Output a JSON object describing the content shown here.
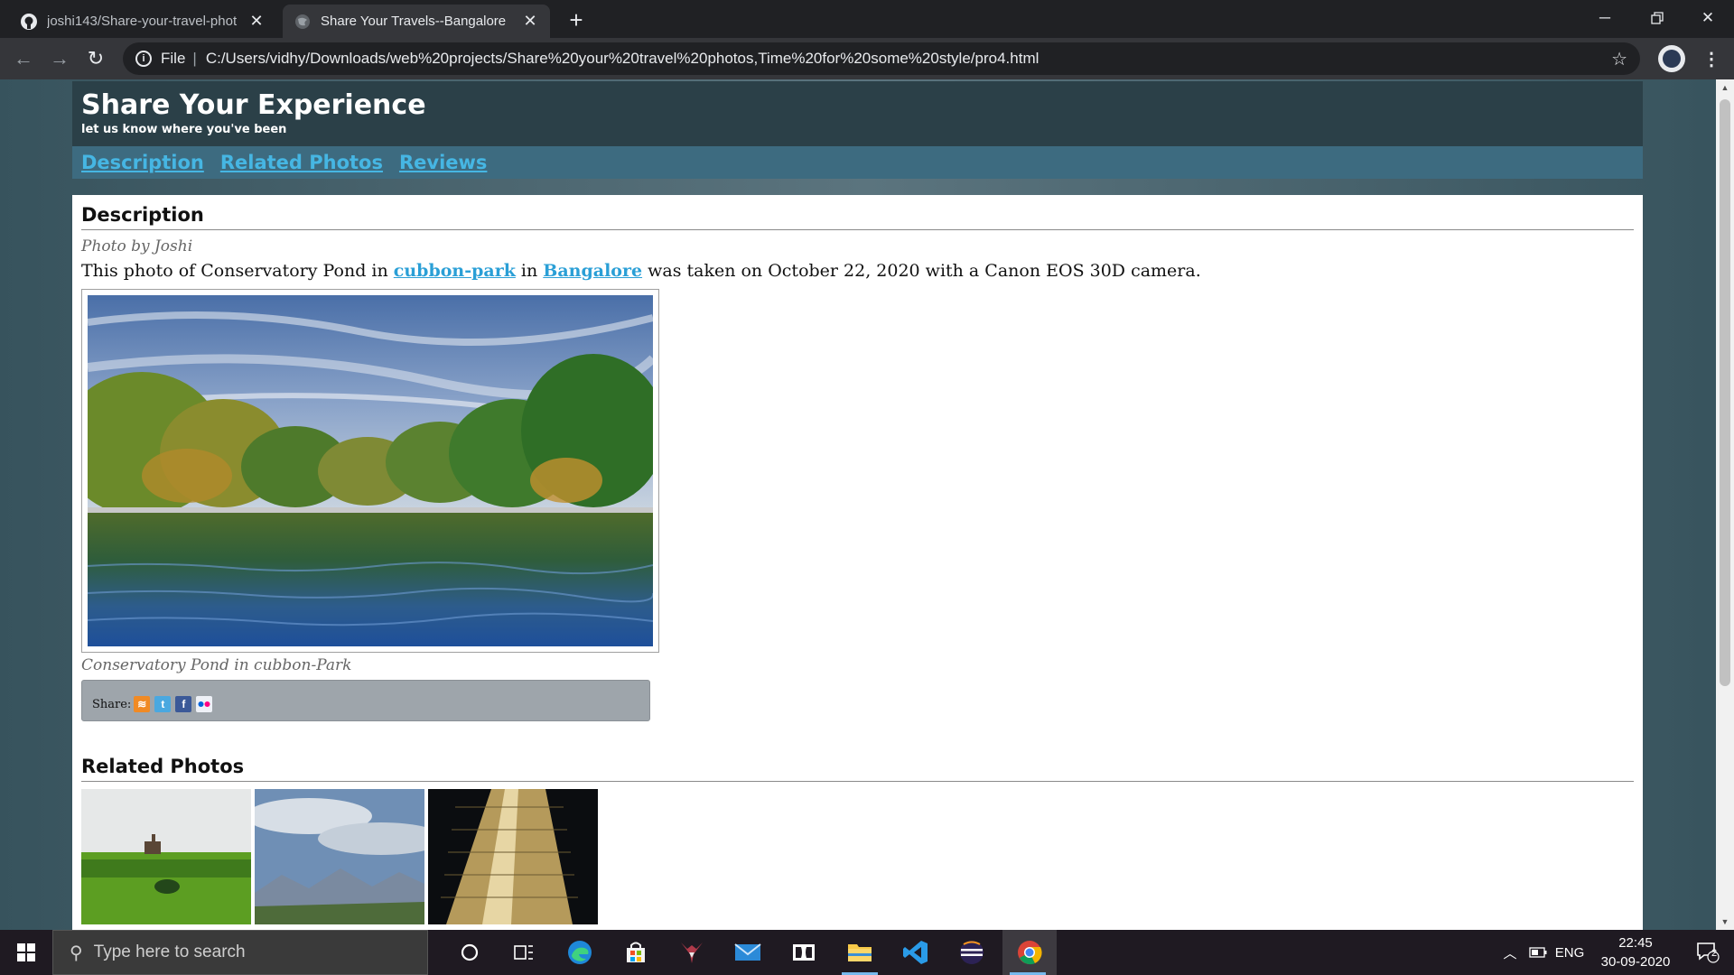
{
  "browser": {
    "tabs": [
      {
        "title": "joshi143/Share-your-travel-phot",
        "favicon": "github-icon"
      },
      {
        "title": "Share Your Travels--Bangalore",
        "favicon": "globe-icon"
      }
    ],
    "address": {
      "scheme_label": "File",
      "url": "C:/Users/vidhy/Downloads/web%20projects/Share%20your%20travel%20photos,Time%20for%20some%20style/pro4.html"
    }
  },
  "site": {
    "title": "Share Your Experience",
    "tagline": "let us know where you've been",
    "nav": [
      "Description",
      "Related Photos",
      "Reviews"
    ]
  },
  "description": {
    "heading": "Description",
    "byline": "Photo by Joshi",
    "sentence_pre": "This photo of Conservatory Pond in ",
    "link_park": "cubbon-park",
    "sentence_mid": " in ",
    "link_city": "Bangalore",
    "sentence_post": " was taken on October 22, 2020 with a Canon EOS 30D camera.",
    "caption": "Conservatory Pond in cubbon-Park",
    "share_label": "Share:",
    "share_icons": [
      "rss-icon",
      "twitter-icon",
      "facebook-icon",
      "flickr-icon"
    ]
  },
  "related": {
    "heading": "Related Photos"
  },
  "taskbar": {
    "search_placeholder": "Type here to search",
    "language": "ENG",
    "time": "22:45",
    "date": "30-09-2020",
    "notification_count": "2"
  }
}
